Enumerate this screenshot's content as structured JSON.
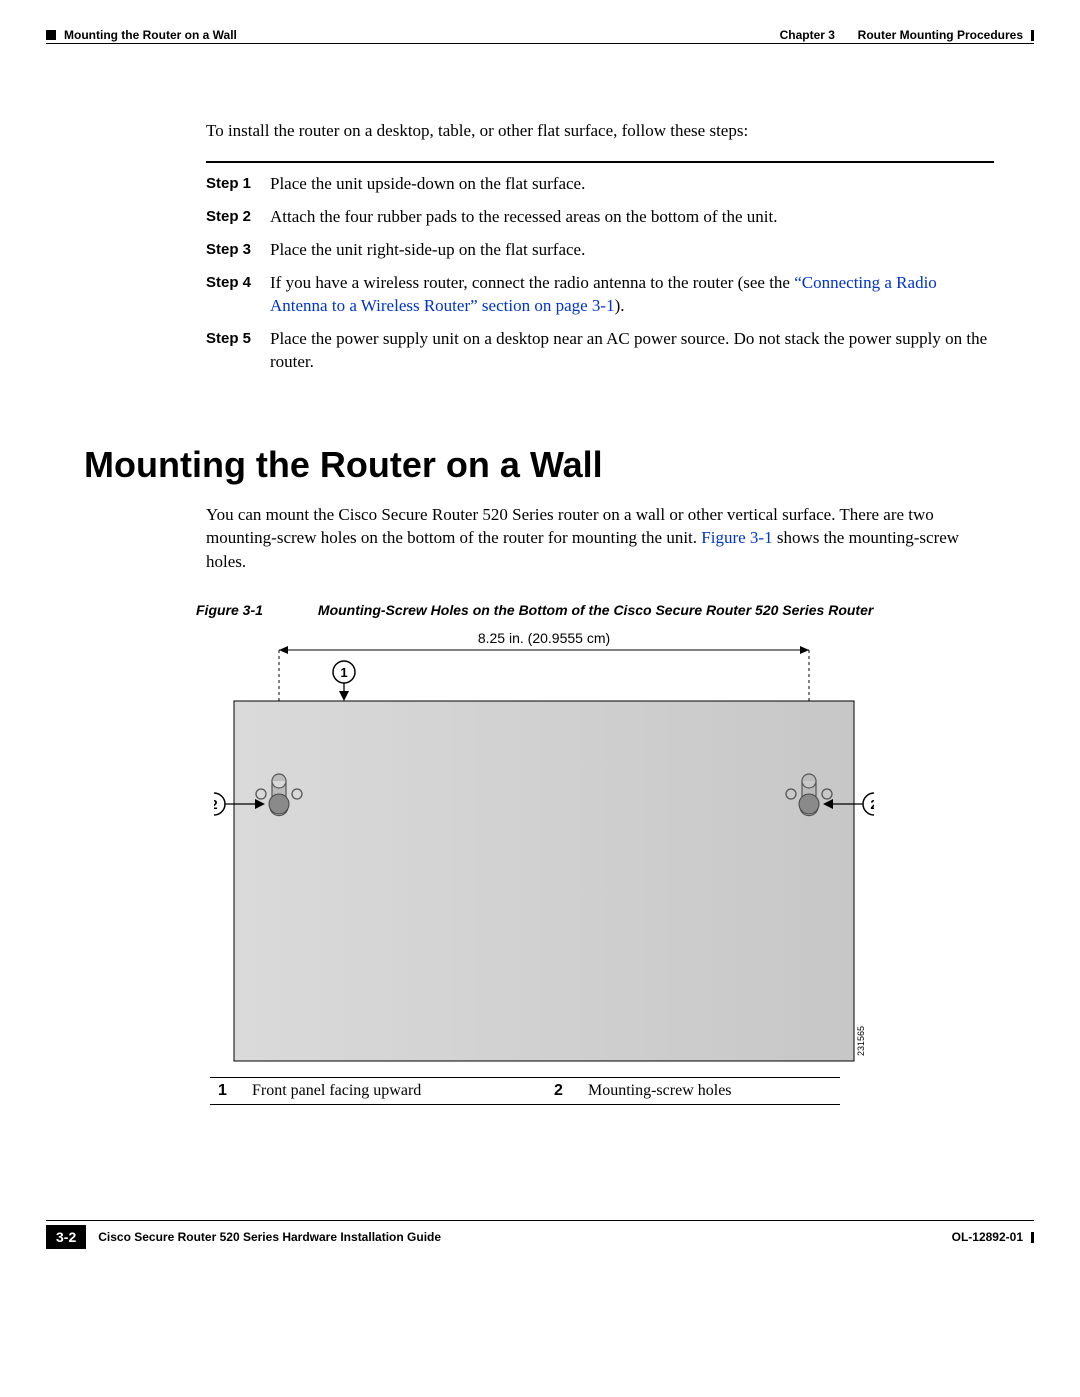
{
  "header": {
    "section": "Mounting the Router on a Wall",
    "chapter_label": "Chapter 3",
    "chapter_title": "Router Mounting Procedures"
  },
  "intro": "To install the router on a desktop, table, or other flat surface, follow these steps:",
  "steps": [
    {
      "label": "Step 1",
      "text": "Place the unit upside-down on the flat surface."
    },
    {
      "label": "Step 2",
      "text": "Attach the four rubber pads to the recessed areas on the bottom of the unit."
    },
    {
      "label": "Step 3",
      "text": "Place the unit right-side-up on the flat surface."
    },
    {
      "label": "Step 4",
      "text_pre": "If you have a wireless router, connect the radio antenna to the router (see the ",
      "link": "“Connecting a Radio Antenna to a Wireless Router” section on page 3-1",
      "text_post": ")."
    },
    {
      "label": "Step 5",
      "text": "Place the power supply unit on a desktop near an AC power source. Do not stack the power supply on the router."
    }
  ],
  "heading": "Mounting the Router on a Wall",
  "body": {
    "pre": "You can mount the Cisco Secure Router 520 Series router on a wall or other vertical surface. There are two mounting-screw holes on the bottom of the router for mounting the unit. ",
    "link": "Figure 3-1",
    "post": " shows the mounting-screw holes."
  },
  "figure": {
    "label": "Figure 3-1",
    "caption": "Mounting-Screw Holes on the Bottom of the Cisco Secure Router 520 Series Router",
    "dimension": "8.25 in. (20.9555 cm)",
    "id": "231565"
  },
  "legend": [
    {
      "num": "1",
      "text": "Front panel facing upward"
    },
    {
      "num": "2",
      "text": "Mounting-screw holes"
    }
  ],
  "footer": {
    "guide": "Cisco Secure Router 520 Series Hardware Installation Guide",
    "page": "3-2",
    "doc": "OL-12892-01"
  }
}
